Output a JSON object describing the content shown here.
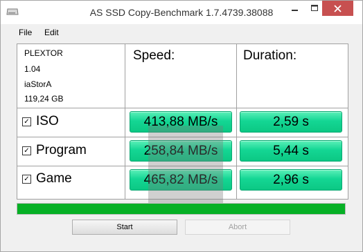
{
  "window": {
    "title": "AS SSD Copy-Benchmark 1.7.4739.38088",
    "controls": {
      "minimize": "–",
      "maximize": "□",
      "close": "✕"
    }
  },
  "menu": {
    "file": "File",
    "edit": "Edit"
  },
  "drive": {
    "model": "PLEXTOR",
    "firmware": "1.04",
    "driver": "iaStorA",
    "size": "119,24 GB"
  },
  "headers": {
    "speed": "Speed:",
    "duration": "Duration:"
  },
  "rows": [
    {
      "label": "ISO",
      "checked": true,
      "check_glyph": "✓",
      "speed": "413,88 MB/s",
      "duration": "2,59 s"
    },
    {
      "label": "Program",
      "checked": true,
      "check_glyph": "✓",
      "speed": "258,84 MB/s",
      "duration": "5,44 s"
    },
    {
      "label": "Game",
      "checked": true,
      "check_glyph": "✓",
      "speed": "465,82 MB/s",
      "duration": "2,96 s"
    }
  ],
  "progress": {
    "percent": 100,
    "color": "#06b025"
  },
  "buttons": {
    "start": "Start",
    "abort": "Abort"
  },
  "colors": {
    "result_green": "#14d694",
    "close_red": "#c75050"
  }
}
